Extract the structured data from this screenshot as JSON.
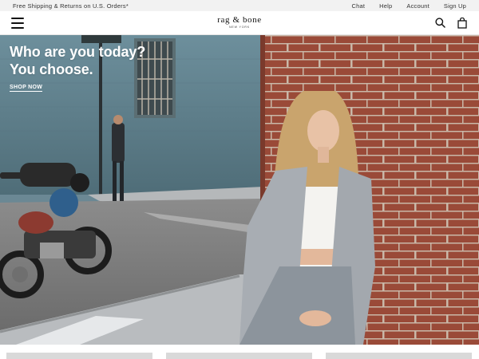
{
  "topbar": {
    "promo": "Free Shipping & Returns on U.S. Orders*",
    "links": [
      "Chat",
      "Help",
      "Account",
      "Sign Up"
    ]
  },
  "header": {
    "brand": "rag & bone",
    "brand_sub": "NEW YORK",
    "icons": [
      "hamburger-menu-icon",
      "search-icon",
      "shopping-bag-icon"
    ]
  },
  "hero": {
    "title": "Who are you today?\nYou choose.",
    "cta": "SHOP NOW"
  },
  "colors": {
    "wall_blue": "#5f7f8c",
    "brick": "#9a4a38",
    "street": "#7d7d7d",
    "sidewalk": "#b9bcbf"
  }
}
